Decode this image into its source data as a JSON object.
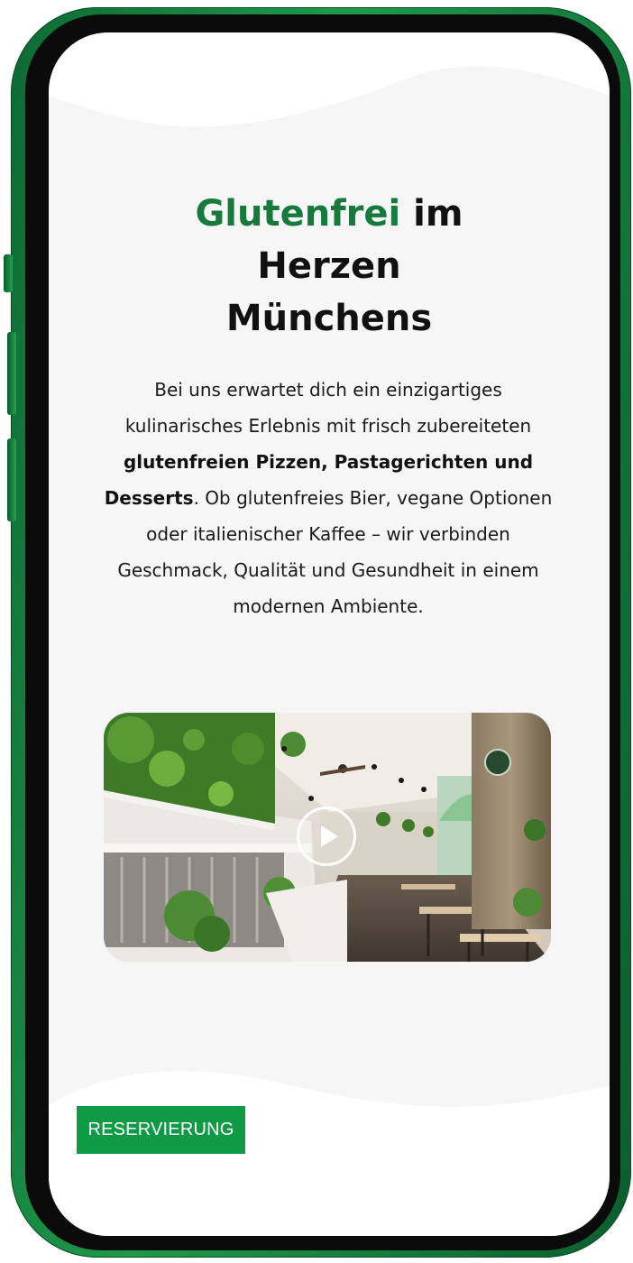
{
  "hero": {
    "title_accent": "Glutenfrei",
    "title_line1_rest": " im",
    "title_line2": "Herzen",
    "title_line3": "Münchens"
  },
  "intro": {
    "text_part1": "Bei uns erwartet dich ein einzigartiges kulinarisches Erlebnis mit frisch zubereiteten ",
    "bold_part": "glutenfreien Pizzen, Pastagerichten und Desserts",
    "text_part2": ". Ob glutenfreies Bier, vegane Optionen oder italienischer Kaffee – wir verbinden Geschmack, Qualität und Gesundheit in einem modernen Ambiente."
  },
  "video": {
    "thumbnail": "restaurant-interior-photo",
    "play_icon": "play-icon"
  },
  "cta": {
    "reserve_label": "RESERVIERUNG"
  },
  "colors": {
    "accent_green": "#157a3b",
    "button_green": "#0f9a46",
    "phone_frame": "#1f9a4b",
    "screen_bg": "#f6f6f6"
  }
}
